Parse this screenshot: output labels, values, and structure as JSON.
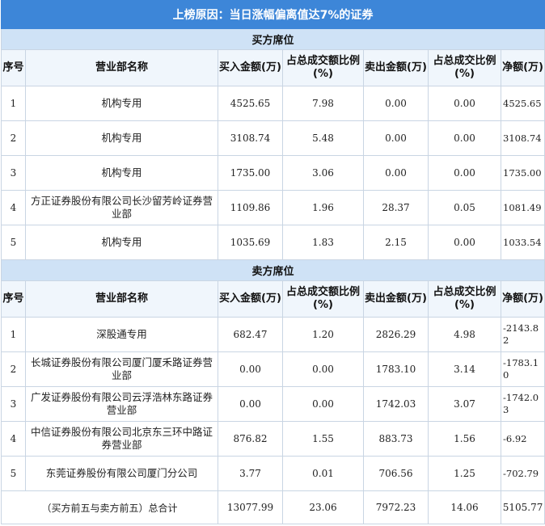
{
  "title": "上榜原因：当日涨幅偏离值达7%的证券",
  "buy_section": "买方席位",
  "sell_section": "卖方席位",
  "headers": [
    "序号",
    "营业部名称",
    "买入金额(万)",
    "占总成交额比例(%)",
    "卖出金额(万)",
    "占总成交比例(%)",
    "净额(万)"
  ],
  "buy_rows": [
    {
      "idx": "1",
      "name": "机构专用",
      "buy": "4525.65",
      "buy_pct": "7.98",
      "sell": "0.00",
      "sell_pct": "0.00",
      "net": "4525.65"
    },
    {
      "idx": "2",
      "name": "机构专用",
      "buy": "3108.74",
      "buy_pct": "5.48",
      "sell": "0.00",
      "sell_pct": "0.00",
      "net": "3108.74"
    },
    {
      "idx": "3",
      "name": "机构专用",
      "buy": "1735.00",
      "buy_pct": "3.06",
      "sell": "0.00",
      "sell_pct": "0.00",
      "net": "1735.00"
    },
    {
      "idx": "4",
      "name": "方正证券股份有限公司长沙留芳岭证券营业部",
      "buy": "1109.86",
      "buy_pct": "1.96",
      "sell": "28.37",
      "sell_pct": "0.05",
      "net": "1081.49"
    },
    {
      "idx": "5",
      "name": "机构专用",
      "buy": "1035.69",
      "buy_pct": "1.83",
      "sell": "2.15",
      "sell_pct": "0.00",
      "net": "1033.54"
    }
  ],
  "sell_rows": [
    {
      "idx": "1",
      "name": "深股通专用",
      "buy": "682.47",
      "buy_pct": "1.20",
      "sell": "2826.29",
      "sell_pct": "4.98",
      "net": "-2143.82"
    },
    {
      "idx": "2",
      "name": "长城证券股份有限公司厦门厦禾路证券营业部",
      "buy": "0.00",
      "buy_pct": "0.00",
      "sell": "1783.10",
      "sell_pct": "3.14",
      "net": "-1783.10"
    },
    {
      "idx": "3",
      "name": "广发证券股份有限公司云浮浩林东路证券营业部",
      "buy": "0.00",
      "buy_pct": "0.00",
      "sell": "1742.03",
      "sell_pct": "3.07",
      "net": "-1742.03"
    },
    {
      "idx": "4",
      "name": "中信证券股份有限公司北京东三环中路证券营业部",
      "buy": "876.82",
      "buy_pct": "1.55",
      "sell": "883.73",
      "sell_pct": "1.56",
      "net": "-6.92"
    },
    {
      "idx": "5",
      "name": "东莞证券股份有限公司厦门分公司",
      "buy": "3.77",
      "buy_pct": "0.01",
      "sell": "706.56",
      "sell_pct": "1.25",
      "net": "-702.79"
    }
  ],
  "total": {
    "label": "（买方前五与卖方前五）总合计",
    "buy": "13077.99",
    "buy_pct": "23.06",
    "sell": "7972.23",
    "sell_pct": "14.06",
    "net": "5105.77"
  }
}
